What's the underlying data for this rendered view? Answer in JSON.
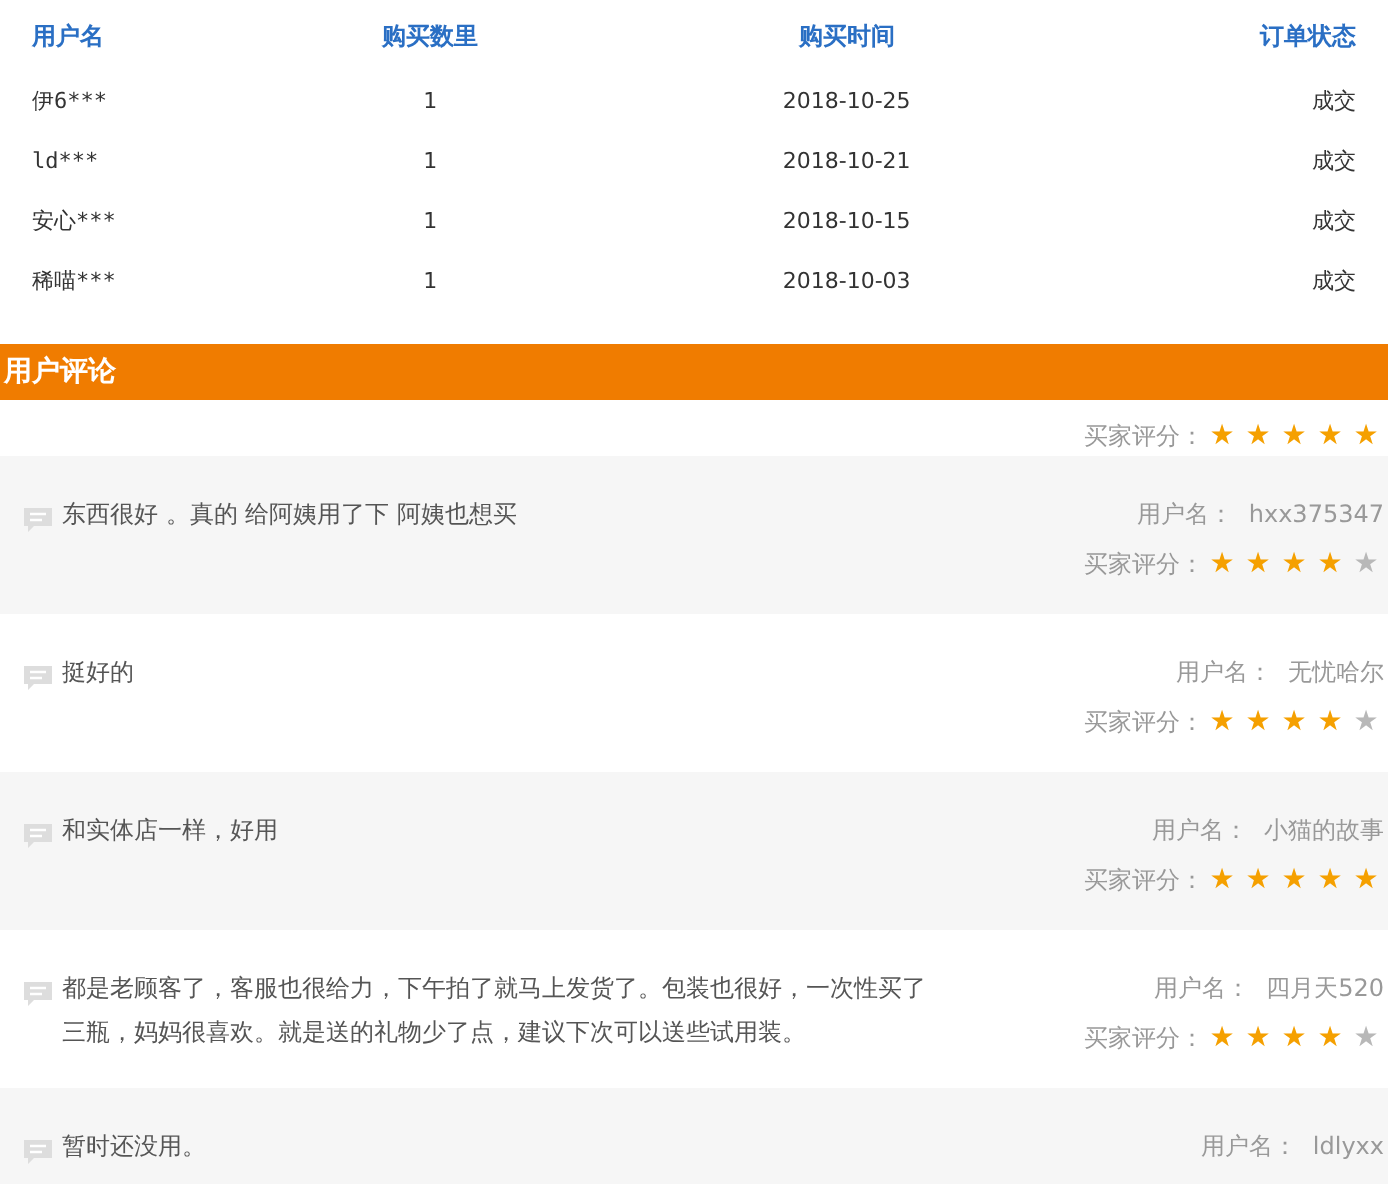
{
  "orders": {
    "columns": [
      "用户名",
      "购买数里",
      "购买时间",
      "订单状态"
    ],
    "rows": [
      [
        "伊6***",
        "1",
        "2018-10-25",
        "成交"
      ],
      [
        "ld***",
        "1",
        "2018-10-21",
        "成交"
      ],
      [
        "安心***",
        "1",
        "2018-10-15",
        "成交"
      ],
      [
        "稀喵***",
        "1",
        "2018-10-03",
        "成交"
      ]
    ]
  },
  "reviews_title": "用户评论",
  "partial_rating": {
    "rating_label": "买家评分：",
    "stars": 5
  },
  "reviews": [
    {
      "text": "东西很好 。真的 给阿姨用了下 阿姨也想买",
      "user_label": "用户名：",
      "user": "hxx375347",
      "rating_label": "买家评分：",
      "stars": 4
    },
    {
      "text": "挺好的",
      "user_label": "用户名：",
      "user": "无忧哈尔",
      "rating_label": "买家评分：",
      "stars": 4
    },
    {
      "text": "和实体店一样，好用",
      "user_label": "用户名：",
      "user": "小猫的故事",
      "rating_label": "买家评分：",
      "stars": 5
    },
    {
      "text": "都是老顾客了，客服也很给力，下午拍了就马上发货了。包装也很好，一次性买了三瓶，妈妈很喜欢。就是送的礼物少了点，建议下次可以送些试用装。",
      "user_label": "用户名：",
      "user": "四月天520",
      "rating_label": "买家评分：",
      "stars": 4
    },
    {
      "text": "暂时还没用。",
      "user_label": "用户名：",
      "user": "ldlyxx"
    }
  ]
}
